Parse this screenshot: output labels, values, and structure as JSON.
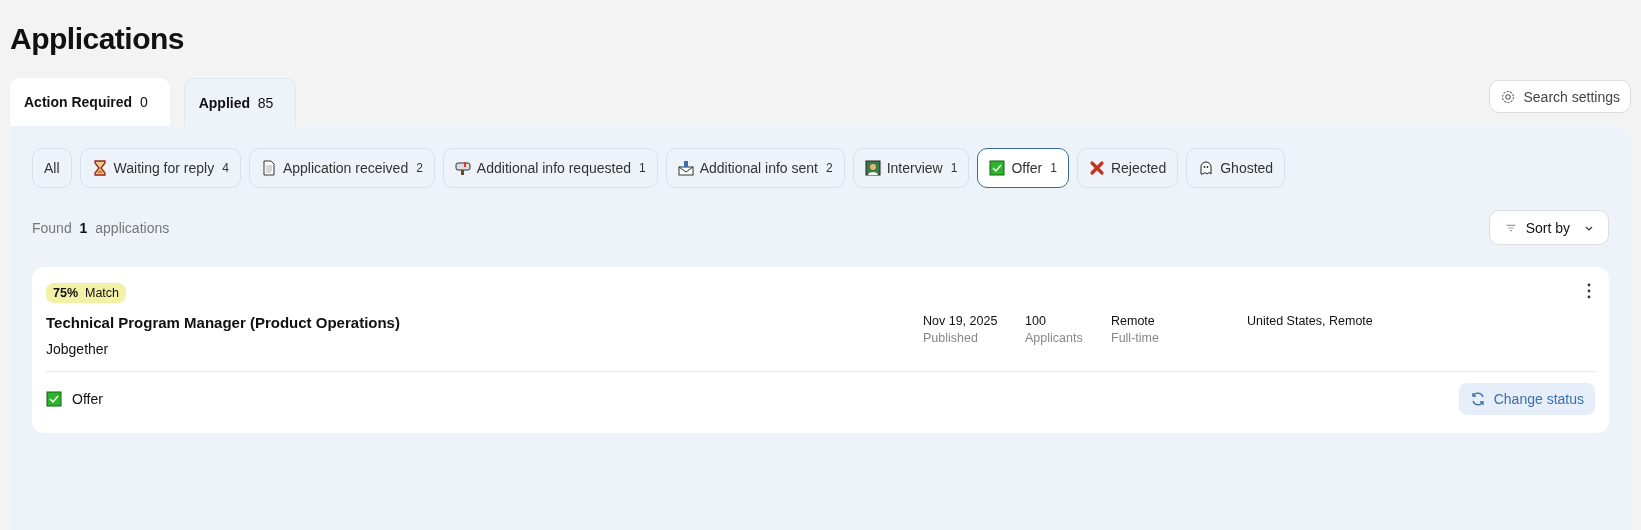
{
  "title": "Applications",
  "tabs": [
    {
      "label": "Action Required",
      "count": "0",
      "selected": false
    },
    {
      "label": "Applied",
      "count": "85",
      "selected": true
    }
  ],
  "search_settings": {
    "label": "Search settings"
  },
  "filters": [
    {
      "kind": "all",
      "label": "All",
      "selected": false
    },
    {
      "kind": "waiting",
      "label": "Waiting for reply",
      "count": "4",
      "selected": false
    },
    {
      "kind": "received",
      "label": "Application received",
      "count": "2",
      "selected": false
    },
    {
      "kind": "requested",
      "label": "Additional info requested",
      "count": "1",
      "selected": false
    },
    {
      "kind": "sent",
      "label": "Additional info sent",
      "count": "2",
      "selected": false
    },
    {
      "kind": "interview",
      "label": "Interview",
      "count": "1",
      "selected": false
    },
    {
      "kind": "offer",
      "label": "Offer",
      "count": "1",
      "selected": true
    },
    {
      "kind": "rejected",
      "label": "Rejected",
      "selected": false
    },
    {
      "kind": "ghosted",
      "label": "Ghosted",
      "selected": false
    }
  ],
  "found": {
    "prefix": "Found",
    "count": "1",
    "suffix": "applications"
  },
  "sort": {
    "label": "Sort by"
  },
  "applications": [
    {
      "match_percent": "75%",
      "match_label": "Match",
      "title": "Technical Program Manager (Product Operations)",
      "company": "Jobgether",
      "details": [
        {
          "value": "Nov 19, 2025",
          "label": "Published"
        },
        {
          "value": "100",
          "label": "Applicants"
        },
        {
          "value": "Remote",
          "label": "Full-time"
        },
        {
          "value": "United States, Remote"
        }
      ],
      "status": {
        "kind": "offer",
        "label": "Offer"
      },
      "action": "Change status"
    }
  ]
}
